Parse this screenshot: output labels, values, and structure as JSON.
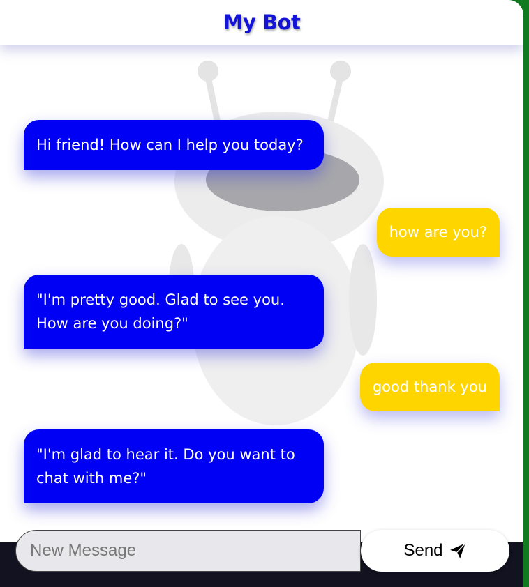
{
  "header": {
    "title": "My Bot"
  },
  "messages": [
    {
      "from": "bot",
      "text": "Hi friend! How can I help you today?"
    },
    {
      "from": "user",
      "text": "how are you?"
    },
    {
      "from": "bot",
      "text": "\"I'm pretty good. Glad to see you. How are you doing?\""
    },
    {
      "from": "user",
      "text": "good thank you"
    },
    {
      "from": "bot",
      "text": "\"I'm glad to hear it. Do you want to chat with me?\""
    }
  ],
  "composer": {
    "placeholder": "New Message",
    "send_label": "Send",
    "send_icon": "paper-plane-icon"
  },
  "colors": {
    "bot_bubble": "#0000f5",
    "user_bubble": "#ffd500",
    "title": "#1414d8",
    "frame": "#0f7a1f"
  }
}
